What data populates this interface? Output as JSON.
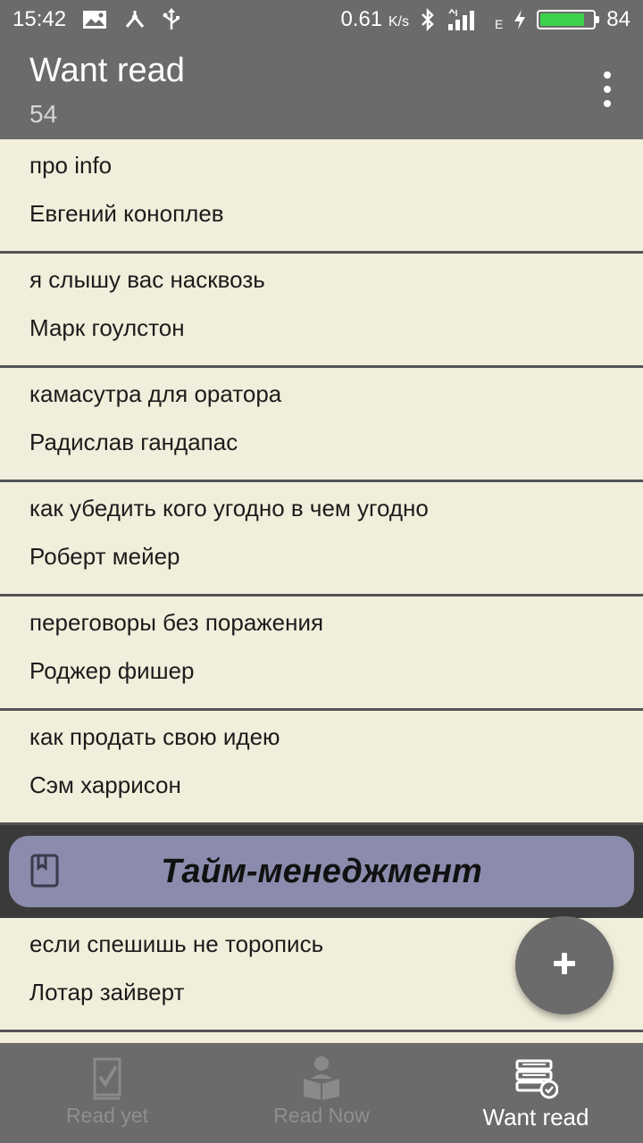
{
  "status_bar": {
    "time": "15:42",
    "net_speed": "0.61",
    "net_unit": "K/s",
    "network_type": "E",
    "battery": "84",
    "battery_level": 0.84,
    "left_icons": [
      "image-icon",
      "share-icon",
      "usb-icon"
    ],
    "right_icons": [
      "bluetooth-icon",
      "signal-icon",
      "charging-icon",
      "battery-icon"
    ]
  },
  "app_bar": {
    "title": "Want read",
    "count": "54"
  },
  "books": [
    {
      "title": "про info",
      "author": "Евгений коноплев"
    },
    {
      "title": "я слышу вас насквозь",
      "author": "Марк гоулстон"
    },
    {
      "title": "камасутра для оратора",
      "author": "Радислав гандапас"
    },
    {
      "title": "как убедить кого угодно в чем угодно",
      "author": "Роберт мейер"
    },
    {
      "title": "переговоры без поражения",
      "author": "Роджер фишер"
    },
    {
      "title": "как продать свою идею",
      "author": "Сэм харрисон"
    }
  ],
  "category": {
    "label": "Тайм-менеджмент",
    "icon": "bookmark-book-icon",
    "color": "#8b8bad"
  },
  "books_after": [
    {
      "title": "если спешишь не торопись",
      "author": "Лотар зайверт"
    }
  ],
  "fab": {
    "symbol": "+",
    "icon": "add-icon"
  },
  "bottom_nav": [
    {
      "label": "Read yet",
      "icon": "checked-book-icon",
      "active": false
    },
    {
      "label": "Read Now",
      "icon": "reading-person-icon",
      "active": false
    },
    {
      "label": "Want read",
      "icon": "book-stack-clock-icon",
      "active": true
    }
  ],
  "colors": {
    "bar": "#6b6b6b",
    "background": "#f1eedb",
    "divider": "#545454",
    "category_pill": "#8b8bad",
    "battery_fill": "#3ed24a"
  }
}
